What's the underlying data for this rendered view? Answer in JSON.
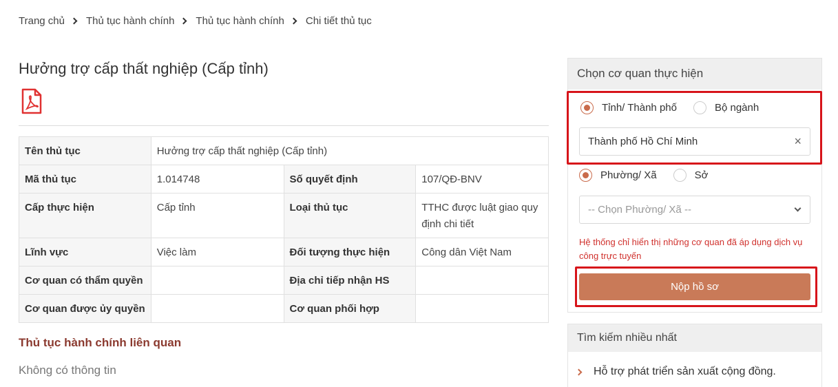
{
  "breadcrumb": [
    "Trang chủ",
    "Thủ tục hành chính",
    "Thủ tục hành chính",
    "Chi tiết thủ tục"
  ],
  "title": "Hưởng trợ cấp thất nghiệp (Cấp tỉnh)",
  "pdf_icon": "pdf-file-icon",
  "table": {
    "ten_thu_tuc_label": "Tên thủ tục",
    "ten_thu_tuc_value": "Hưởng trợ cấp thất nghiệp (Cấp tỉnh)",
    "ma_thu_tuc_label": "Mã thủ tục",
    "ma_thu_tuc_value": "1.014748",
    "so_quyet_dinh_label": "Số quyết định",
    "so_quyet_dinh_value": "107/QĐ-BNV",
    "cap_thuc_hien_label": "Cấp thực hiện",
    "cap_thuc_hien_value": "Cấp tỉnh",
    "loai_thu_tuc_label": "Loại thủ tục",
    "loai_thu_tuc_value": "TTHC được luật giao quy định chi tiết",
    "linh_vuc_label": "Lĩnh vực",
    "linh_vuc_value": "Việc làm",
    "doi_tuong_label": "Đối tượng thực hiện",
    "doi_tuong_value": "Công dân Việt Nam",
    "co_quan_tham_quyen_label": "Cơ quan có thẩm quyền",
    "co_quan_tham_quyen_value": "",
    "dia_chi_tiep_nhan_label": "Địa chỉ tiếp nhận HS",
    "dia_chi_tiep_nhan_value": "",
    "co_quan_uy_quyen_label": "Cơ quan được ủy quyền",
    "co_quan_uy_quyen_value": "",
    "co_quan_phoi_hop_label": "Cơ quan phối hợp",
    "co_quan_phoi_hop_value": ""
  },
  "related": {
    "title": "Thủ tục hành chính liên quan",
    "empty": "Không có thông tin"
  },
  "panel": {
    "heading": "Chọn cơ quan thực hiện",
    "radio1": {
      "option_a": "Tỉnh/ Thành phố",
      "option_b": "Bộ ngành",
      "selected": "option_a"
    },
    "province_value": "Thành phố Hồ Chí Minh",
    "clear_symbol": "×",
    "radio2": {
      "option_a": "Phường/ Xã",
      "option_b": "Sở",
      "selected": "option_a"
    },
    "ward_placeholder": "-- Chọn Phường/ Xã --",
    "note": "Hệ thống chỉ hiển thị những cơ quan đã áp dụng dịch vụ công trực tuyến",
    "submit_label": "Nộp hồ sơ"
  },
  "popular": {
    "heading": "Tìm kiếm nhiều nhất",
    "items": [
      "Hỗ trợ phát triển sản xuất cộng đồng."
    ]
  },
  "colors": {
    "accent": "#c97a58",
    "highlight": "#d7141a",
    "related_title": "#8b3a2f",
    "note": "#d0312d"
  }
}
